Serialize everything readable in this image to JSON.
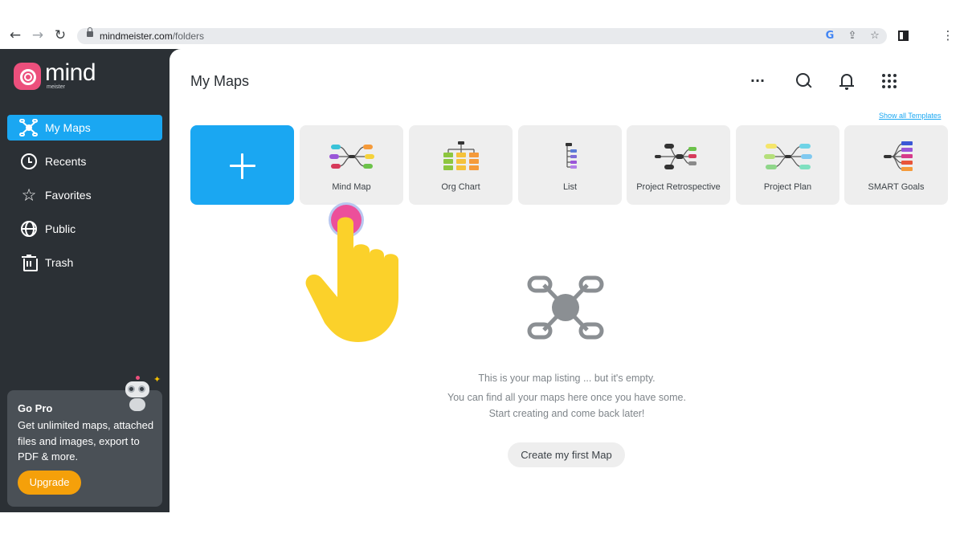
{
  "browser": {
    "url_domain": "mindmeister.com",
    "url_path": "/folders",
    "back_icon": "arrow-left-icon",
    "forward_icon": "arrow-right-icon",
    "reload_icon": "reload-icon"
  },
  "brand": {
    "name": "mind",
    "sub": "meister",
    "color": "#ec4f7c"
  },
  "sidebar": {
    "items": [
      {
        "label": "My Maps",
        "icon": "mind-map-icon"
      },
      {
        "label": "Recents",
        "icon": "clock-icon"
      },
      {
        "label": "Favorites",
        "icon": "star-icon"
      },
      {
        "label": "Public",
        "icon": "globe-icon"
      },
      {
        "label": "Trash",
        "icon": "trash-icon"
      }
    ],
    "active_color": "#1aa7f2"
  },
  "gopro": {
    "title": "Go Pro",
    "text": "Get unlimited maps, attached files and images, export to PDF & more.",
    "button": "Upgrade",
    "button_color": "#f5a00a"
  },
  "header": {
    "title": "My Maps",
    "show_all": "Show all Templates"
  },
  "templates": [
    {
      "label": "Mind Map"
    },
    {
      "label": "Org Chart"
    },
    {
      "label": "List"
    },
    {
      "label": "Project Retrospective"
    },
    {
      "label": "Project Plan"
    },
    {
      "label": "SMART Goals"
    }
  ],
  "empty": {
    "line1": "This is your map listing ... but it's empty.",
    "line2": "You can find all your maps here once you have some.",
    "line3": "Start creating and come back later!",
    "button": "Create my first Map"
  }
}
